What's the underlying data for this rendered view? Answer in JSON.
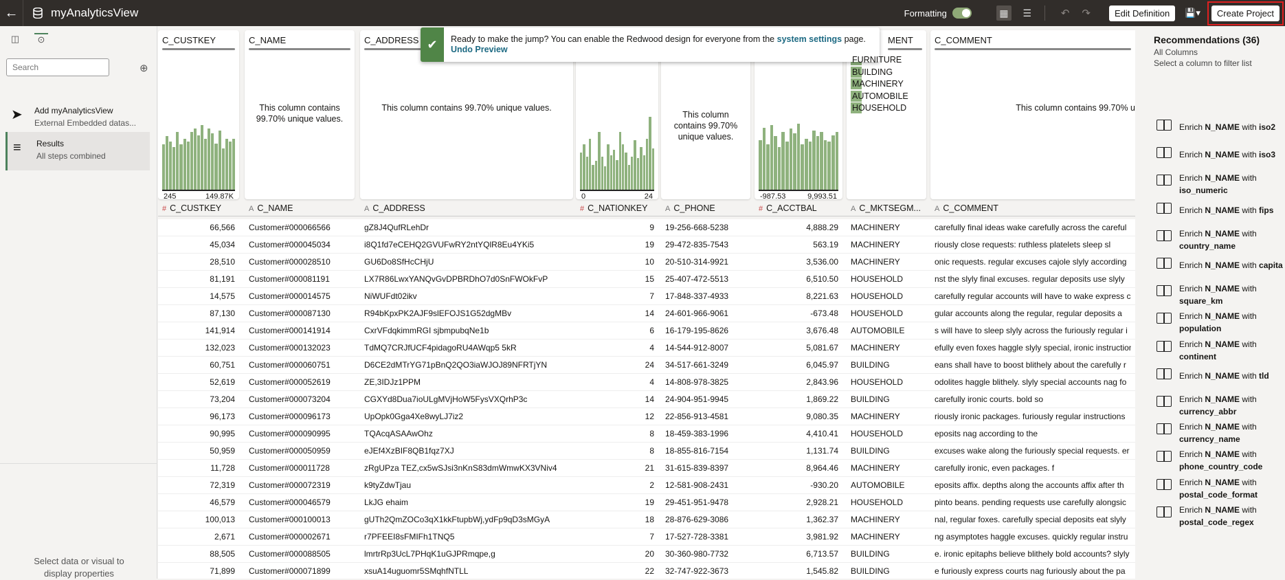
{
  "header": {
    "title": "myAnalyticsView",
    "formatting": "Formatting",
    "edit_definition": "Edit Definition",
    "create_project": "Create Project"
  },
  "left": {
    "search_placeholder": "Search",
    "steps": [
      {
        "title": "Add myAnalyticsView",
        "sub": "External Embedded datas..."
      },
      {
        "title": "Results",
        "sub": "All steps combined"
      }
    ],
    "footer": "Select data or visual to display properties"
  },
  "toast": {
    "text": "Ready to make the jump? You can enable the Redwood design for everyone from the",
    "link": "system settings",
    "suffix": "page.",
    "undo": "Undo Preview"
  },
  "cards": {
    "custkey": {
      "title": "C_CUSTKEY",
      "min": "245",
      "max": "149.87K",
      "hist": [
        0.55,
        0.65,
        0.58,
        0.52,
        0.7,
        0.55,
        0.62,
        0.58,
        0.7,
        0.74,
        0.66,
        0.78,
        0.62,
        0.74,
        0.68,
        0.56,
        0.72,
        0.5,
        0.62,
        0.58,
        0.62
      ]
    },
    "name": {
      "title": "C_NAME",
      "msg": "This column contains 99.70% unique values."
    },
    "address": {
      "title": "C_ADDRESS",
      "msg": "This column contains 99.70% unique values."
    },
    "nationkey": {
      "hist": [
        0.45,
        0.55,
        0.4,
        0.62,
        0.3,
        0.35,
        0.7,
        0.4,
        0.28,
        0.55,
        0.42,
        0.48,
        0.36,
        0.7,
        0.55,
        0.45,
        0.3,
        0.4,
        0.6,
        0.38,
        0.52,
        0.42,
        0.62,
        0.88,
        0.5
      ],
      "min": "0",
      "max": "24"
    },
    "phone": {
      "msg": "This column contains 99.70% unique values."
    },
    "acctbal": {
      "hist": [
        0.6,
        0.75,
        0.55,
        0.78,
        0.65,
        0.52,
        0.7,
        0.58,
        0.74,
        0.68,
        0.8,
        0.55,
        0.62,
        0.58,
        0.72,
        0.65,
        0.7,
        0.6,
        0.58,
        0.66,
        0.7
      ],
      "min": "-987.53",
      "max": "9,993.51"
    },
    "mktsegment": {
      "title": "MENT",
      "cats": [
        {
          "label": "FURNITURE",
          "pct": 0.19
        },
        {
          "label": "BUILDING",
          "pct": 0.2
        },
        {
          "label": "MACHINERY",
          "pct": 0.2
        },
        {
          "label": "AUTOMOBILE",
          "pct": 0.2
        },
        {
          "label": "HOUSEHOLD",
          "pct": 0.21
        }
      ]
    },
    "comment": {
      "title": "C_COMMENT",
      "msg": "This column contains 99.70% u"
    }
  },
  "columns": [
    {
      "type": "#",
      "name": "C_CUSTKEY"
    },
    {
      "type": "A",
      "name": "C_NAME"
    },
    {
      "type": "A",
      "name": "C_ADDRESS"
    },
    {
      "type": "#",
      "name": "C_NATIONKEY"
    },
    {
      "type": "A",
      "name": "C_PHONE"
    },
    {
      "type": "#",
      "name": "C_ACCTBAL"
    },
    {
      "type": "A",
      "name": "C_MKTSEGM..."
    },
    {
      "type": "A",
      "name": "C_COMMENT"
    }
  ],
  "rows": [
    [
      "66,566",
      "Customer#000066566",
      "gZ8J4QufRLehDr",
      "9",
      "19-256-668-5238",
      "4,888.29",
      "MACHINERY",
      "carefully final ideas wake carefully across the careful"
    ],
    [
      "45,034",
      "Customer#000045034",
      "i8Q1fd7eCEHQ2GVUFwRY2ntYQlR8Eu4YKi5",
      "19",
      "29-472-835-7543",
      "563.19",
      "MACHINERY",
      "riously close requests: ruthless platelets sleep sl"
    ],
    [
      "28,510",
      "Customer#000028510",
      "GU6Do8SfHcCHjU",
      "10",
      "20-510-314-9921",
      "3,536.00",
      "MACHINERY",
      "onic requests. regular excuses cajole slyly according"
    ],
    [
      "81,191",
      "Customer#000081191",
      "LX7R86LwxYANQvGvDPBRDhO7d0SnFWOkFvP",
      "15",
      "25-407-472-5513",
      "6,510.50",
      "HOUSEHOLD",
      "nst the slyly final excuses. regular deposits use slyly"
    ],
    [
      "14,575",
      "Customer#000014575",
      "NiWUFdt02ikv",
      "7",
      "17-848-337-4933",
      "8,221.63",
      "HOUSEHOLD",
      "carefully regular accounts will have to wake express c"
    ],
    [
      "87,130",
      "Customer#000087130",
      "R94bKpxPK2AJF9slEFOJS1G52dgMBv",
      "14",
      "24-601-966-9061",
      "-673.48",
      "HOUSEHOLD",
      "gular accounts along the regular, regular deposits a"
    ],
    [
      "141,914",
      "Customer#000141914",
      "CxrVFdqkimmRGI sjbmpubqNe1b",
      "6",
      "16-179-195-8626",
      "3,676.48",
      "AUTOMOBILE",
      "s will have to sleep slyly across the furiously regular i"
    ],
    [
      "132,023",
      "Customer#000132023",
      "TdMQ7CRJfUCF4pidagoRU4AWqp5 5kR",
      "4",
      "14-544-912-8007",
      "5,081.67",
      "MACHINERY",
      "efully even foxes haggle slyly special, ironic instructions. c"
    ],
    [
      "60,751",
      "Customer#000060751",
      "D6CE2dMTrYG71pBnQ2QO3iaWJOJ89NFRTjYN",
      "24",
      "34-517-661-3249",
      "6,045.97",
      "BUILDING",
      "eans shall have to boost blithely about the carefully r"
    ],
    [
      "52,619",
      "Customer#000052619",
      "ZE,3IDJz1PPM",
      "4",
      "14-808-978-3825",
      "2,843.96",
      "HOUSEHOLD",
      "odolites haggle blithely. slyly special accounts nag fo"
    ],
    [
      "73,204",
      "Customer#000073204",
      "CGXYd8Dua7ioULgMVjHoW5FysVXQrhP3c",
      "14",
      "24-904-951-9945",
      "1,869.22",
      "BUILDING",
      "carefully ironic courts. bold so"
    ],
    [
      "96,173",
      "Customer#000096173",
      "UpOpk0Gga4Xe8wyLJ7iz2",
      "12",
      "22-856-913-4581",
      "9,080.35",
      "MACHINERY",
      "riously ironic packages. furiously regular instructions"
    ],
    [
      "90,995",
      "Customer#000090995",
      "TQAcqASAAwOhz",
      "8",
      "18-459-383-1996",
      "4,410.41",
      "HOUSEHOLD",
      "eposits nag according to the"
    ],
    [
      "50,959",
      "Customer#000050959",
      "eJEf4XzBIF8QB1fqz7XJ",
      "8",
      "18-855-816-7154",
      "1,131.74",
      "BUILDING",
      "excuses wake along the furiously special requests. er"
    ],
    [
      "11,728",
      "Customer#000011728",
      "zRgUPza TEZ,cx5wSJsi3nKnS83dmWmwKX3VNiv4",
      "21",
      "31-615-839-8397",
      "8,964.46",
      "MACHINERY",
      "carefully ironic, even packages. f"
    ],
    [
      "72,319",
      "Customer#000072319",
      "k9tyZdwTjau",
      "2",
      "12-581-908-2431",
      "-930.20",
      "AUTOMOBILE",
      "eposits affix. depths along the accounts affix after th"
    ],
    [
      "46,579",
      "Customer#000046579",
      "LkJG ehaim",
      "19",
      "29-451-951-9478",
      "2,928.21",
      "HOUSEHOLD",
      "pinto beans. pending requests use carefully alongsic"
    ],
    [
      "100,013",
      "Customer#000100013",
      "gUTh2QmZOCo3qX1kkFtupbWj,ydFp9qD3sMGyA",
      "18",
      "28-876-629-3086",
      "1,362.37",
      "MACHINERY",
      "nal, regular foxes. carefully special deposits eat slyly"
    ],
    [
      "2,671",
      "Customer#000002671",
      "r7PFEEI8sFMIFh1TNQ5",
      "7",
      "17-527-728-3381",
      "3,981.92",
      "MACHINERY",
      "ng asymptotes haggle excuses. quickly regular instru"
    ],
    [
      "88,505",
      "Customer#000088505",
      "lmrtrRp3UcL7PHqK1uGJPRmqpe,g",
      "20",
      "30-360-980-7732",
      "6,713.57",
      "BUILDING",
      "e. ironic epitaphs believe blithely bold accounts? slyly"
    ],
    [
      "71,899",
      "Customer#000071899",
      "xsuA14uguomr5SMqhfNTLL",
      "22",
      "32-747-922-3673",
      "1,545.82",
      "BUILDING",
      "e furiously express courts nag furiously about the pa"
    ]
  ],
  "recommendations": {
    "title": "Recommendations (36)",
    "sub1": "All Columns",
    "sub2": "Select a column to filter list",
    "items": [
      [
        "Enrich ",
        "N_NAME",
        " with ",
        "iso2",
        ""
      ],
      [
        "Enrich ",
        "N_NAME",
        " with ",
        "iso3",
        ""
      ],
      [
        "Enrich ",
        "N_NAME",
        " with",
        "",
        "iso_numeric"
      ],
      [
        "Enrich ",
        "N_NAME",
        " with ",
        "fips",
        ""
      ],
      [
        "Enrich ",
        "N_NAME",
        " with",
        "",
        "country_name"
      ],
      [
        "Enrich ",
        "N_NAME",
        " with ",
        "capita",
        ""
      ],
      [
        "Enrich ",
        "N_NAME",
        " with",
        "",
        "square_km"
      ],
      [
        "Enrich ",
        "N_NAME",
        " with",
        "",
        "population"
      ],
      [
        "Enrich ",
        "N_NAME",
        " with",
        "",
        "continent"
      ],
      [
        "Enrich ",
        "N_NAME",
        " with ",
        "tld",
        ""
      ],
      [
        "Enrich ",
        "N_NAME",
        " with",
        "",
        "currency_abbr"
      ],
      [
        "Enrich ",
        "N_NAME",
        " with",
        "",
        "currency_name"
      ],
      [
        "Enrich ",
        "N_NAME",
        " with",
        "",
        "phone_country_code"
      ],
      [
        "Enrich ",
        "N_NAME",
        " with",
        "",
        "postal_code_format"
      ],
      [
        "Enrich ",
        "N_NAME",
        " with",
        "",
        "postal_code_regex"
      ]
    ]
  }
}
